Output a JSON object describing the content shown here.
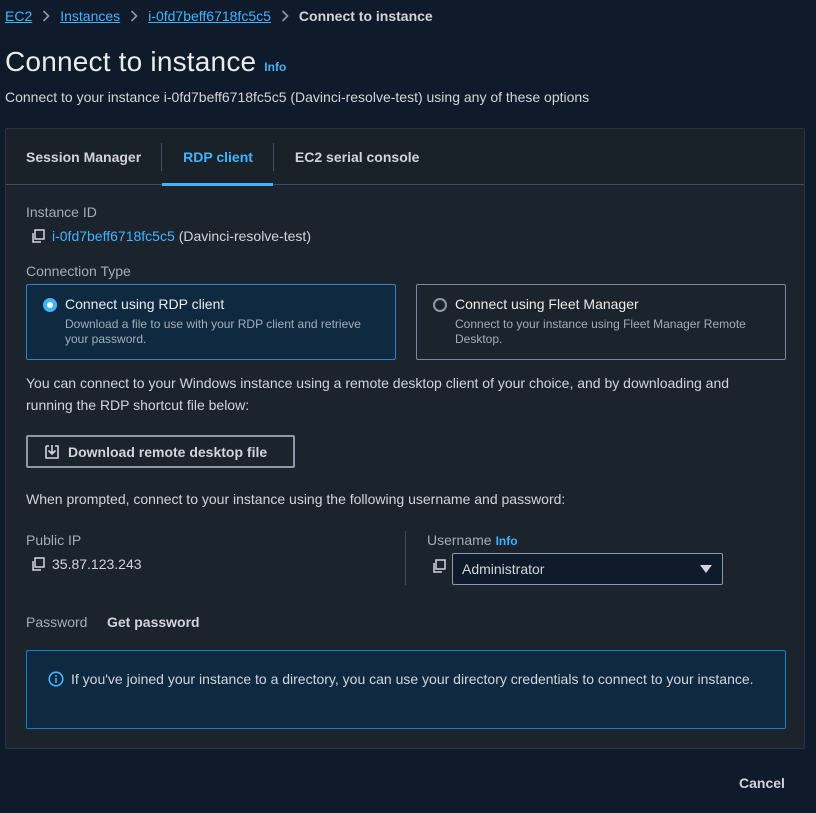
{
  "breadcrumb": {
    "items": [
      "EC2",
      "Instances",
      "i-0fd7beff6718fc5c5"
    ],
    "current": "Connect to instance"
  },
  "header": {
    "title": "Connect to instance",
    "info": "Info",
    "subtitle": "Connect to your instance i-0fd7beff6718fc5c5 (Davinci-resolve-test) using any of these options"
  },
  "tabs": [
    {
      "label": "Session Manager",
      "active": false
    },
    {
      "label": "RDP client",
      "active": true
    },
    {
      "label": "EC2 serial console",
      "active": false
    }
  ],
  "instance": {
    "label": "Instance ID",
    "id": "i-0fd7beff6718fc5c5",
    "name": "(Davinci-resolve-test)"
  },
  "connection_type": {
    "label": "Connection Type",
    "options": [
      {
        "title": "Connect using RDP client",
        "description": "Download a file to use with your RDP client and retrieve your password.",
        "selected": true
      },
      {
        "title": "Connect using Fleet Manager",
        "description": "Connect to your instance using Fleet Manager Remote Desktop.",
        "selected": false
      }
    ]
  },
  "rdp": {
    "intro": "You can connect to your Windows instance using a remote desktop client of your choice, and by downloading and running the RDP shortcut file below:",
    "download_label": "Download remote desktop file",
    "prompt_text": "When prompted, connect to your instance using the following username and password:"
  },
  "credentials": {
    "public_ip_label": "Public IP",
    "public_ip": "35.87.123.243",
    "username_label": "Username",
    "username_info": "Info",
    "username_value": "Administrator",
    "password_label": "Password",
    "get_password": "Get password"
  },
  "alert": {
    "text": "If you've joined your instance to a directory, you can use your directory credentials to connect to your instance."
  },
  "footer": {
    "cancel": "Cancel"
  },
  "colors": {
    "background": "#0f1b2a",
    "panel": "#1b232d",
    "link": "#42b4ff",
    "alert_bg": "#0f2a40"
  }
}
